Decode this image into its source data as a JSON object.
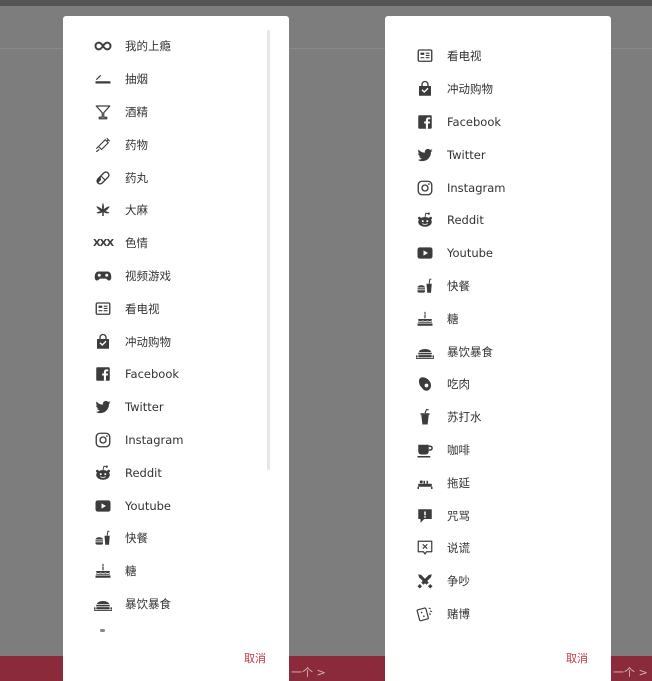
{
  "background": {
    "next_label": "一个 >"
  },
  "colors": {
    "accent": "#c0394b",
    "text": "#333333",
    "icon": "#3c3c3c",
    "overlay": "#7d7d7d",
    "footer_bar": "#8a2a3a"
  },
  "left_panel": {
    "items": [
      {
        "icon": "infinity-icon",
        "label": "我的上瘾"
      },
      {
        "icon": "cigarette-icon",
        "label": "抽烟"
      },
      {
        "icon": "martini-glass-icon",
        "label": "酒精"
      },
      {
        "icon": "syringe-icon",
        "label": "药物"
      },
      {
        "icon": "pill-icon",
        "label": "药丸"
      },
      {
        "icon": "cannabis-leaf-icon",
        "label": "大麻"
      },
      {
        "icon": "xxx-icon",
        "label": "色情",
        "icon_text": "XXX"
      },
      {
        "icon": "gamepad-icon",
        "label": "视频游戏"
      },
      {
        "icon": "tv-guide-icon",
        "label": "看电视"
      },
      {
        "icon": "shopping-bag-icon",
        "label": "冲动购物"
      },
      {
        "icon": "facebook-icon",
        "label": "Facebook"
      },
      {
        "icon": "twitter-icon",
        "label": "Twitter"
      },
      {
        "icon": "instagram-icon",
        "label": "Instagram"
      },
      {
        "icon": "reddit-icon",
        "label": "Reddit"
      },
      {
        "icon": "youtube-icon",
        "label": "Youtube"
      },
      {
        "icon": "fast-food-icon",
        "label": "快餐"
      },
      {
        "icon": "cake-icon",
        "label": "糖"
      },
      {
        "icon": "binge-eating-icon",
        "label": "暴饮暴食"
      }
    ],
    "cancel_label": "取消"
  },
  "right_panel": {
    "items": [
      {
        "icon": "tv-guide-icon",
        "label": "看电视"
      },
      {
        "icon": "shopping-bag-icon",
        "label": "冲动购物"
      },
      {
        "icon": "facebook-icon",
        "label": "Facebook"
      },
      {
        "icon": "twitter-icon",
        "label": "Twitter"
      },
      {
        "icon": "instagram-icon",
        "label": "Instagram"
      },
      {
        "icon": "reddit-icon",
        "label": "Reddit"
      },
      {
        "icon": "youtube-icon",
        "label": "Youtube"
      },
      {
        "icon": "fast-food-icon",
        "label": "快餐"
      },
      {
        "icon": "cake-icon",
        "label": "糖"
      },
      {
        "icon": "binge-eating-icon",
        "label": "暴饮暴食"
      },
      {
        "icon": "meat-icon",
        "label": "吃肉"
      },
      {
        "icon": "soda-icon",
        "label": "苏打水"
      },
      {
        "icon": "coffee-icon",
        "label": "咖啡"
      },
      {
        "icon": "procrastination-icon",
        "label": "拖延"
      },
      {
        "icon": "swearing-icon",
        "label": "咒骂"
      },
      {
        "icon": "lying-icon",
        "label": "说谎"
      },
      {
        "icon": "fighting-icon",
        "label": "争吵"
      },
      {
        "icon": "gambling-icon",
        "label": "赌博"
      }
    ],
    "cancel_label": "取消"
  }
}
